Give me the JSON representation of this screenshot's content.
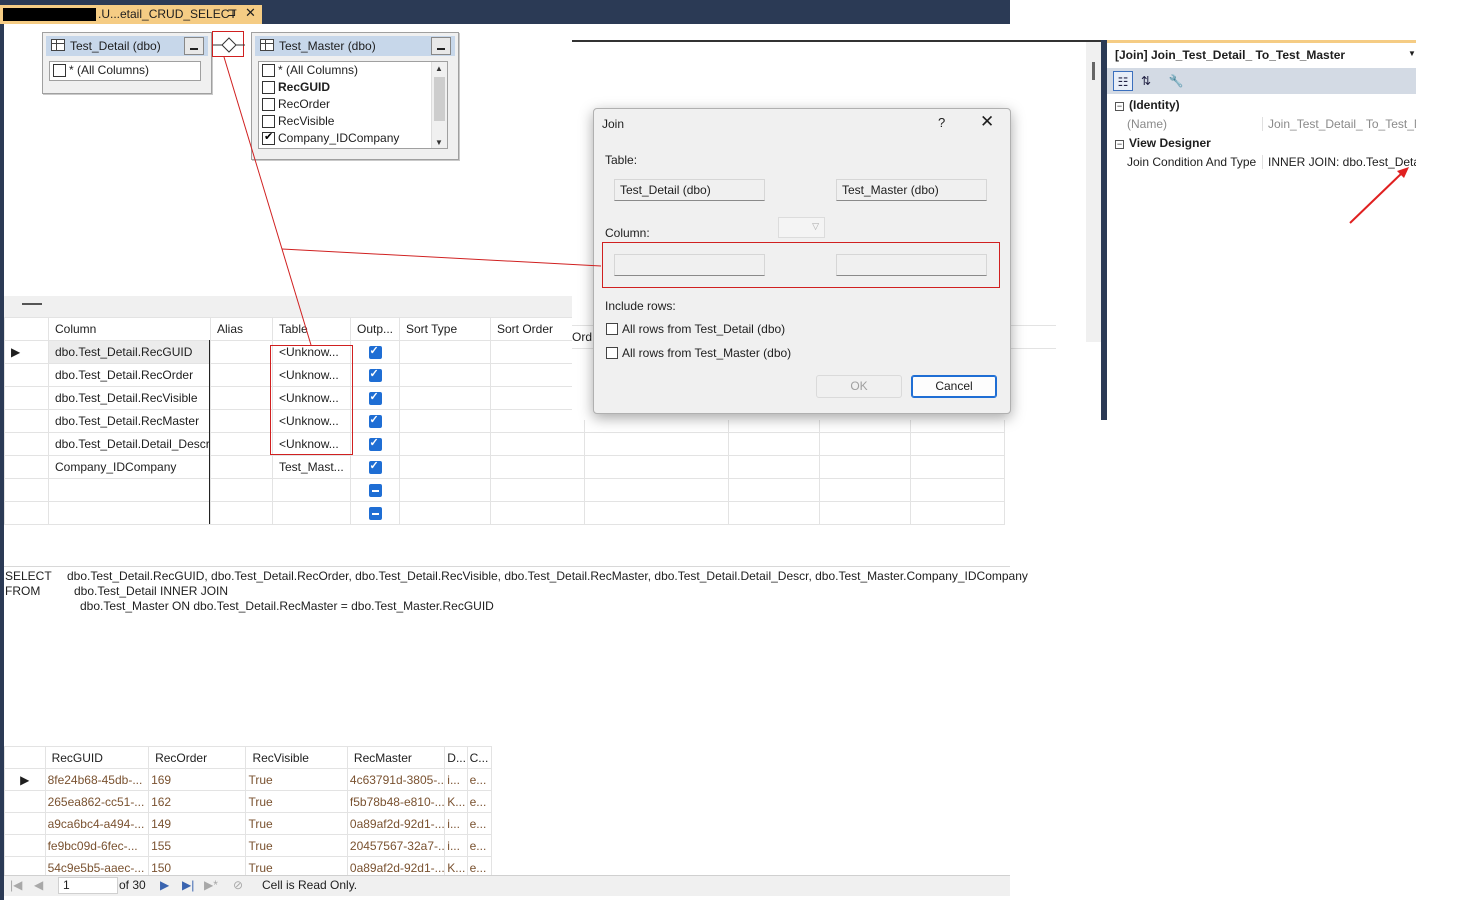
{
  "tab": {
    "title": ".U...etail_CRUD_SELECT",
    "pin": "⊐",
    "close": "✕"
  },
  "diagram": {
    "tables": [
      {
        "title": "Test_Detail (dbo)",
        "columns": [
          {
            "name": "* (All Columns)",
            "checked": false,
            "bold": false
          }
        ]
      },
      {
        "title": "Test_Master (dbo)",
        "columns": [
          {
            "name": "* (All Columns)",
            "checked": false,
            "bold": false
          },
          {
            "name": "RecGUID",
            "checked": false,
            "bold": true
          },
          {
            "name": "RecOrder",
            "checked": false,
            "bold": false
          },
          {
            "name": "RecVisible",
            "checked": false,
            "bold": false
          },
          {
            "name": "Company_IDCompany",
            "checked": true,
            "bold": false
          }
        ]
      }
    ]
  },
  "criteria": {
    "headers": [
      "Column",
      "Alias",
      "Table",
      "Outp...",
      "Sort Type",
      "Sort Order"
    ],
    "rows": [
      {
        "column": "dbo.Test_Detail.RecGUID",
        "alias": "",
        "table": "<Unknow...",
        "output": "checked",
        "current": true
      },
      {
        "column": "dbo.Test_Detail.RecOrder",
        "alias": "",
        "table": "<Unknow...",
        "output": "checked",
        "current": false
      },
      {
        "column": "dbo.Test_Detail.RecVisible",
        "alias": "",
        "table": "<Unknow...",
        "output": "checked",
        "current": false
      },
      {
        "column": "dbo.Test_Detail.RecMaster",
        "alias": "",
        "table": "<Unknow...",
        "output": "checked",
        "current": false
      },
      {
        "column": "dbo.Test_Detail.Detail_Descr",
        "alias": "",
        "table": "<Unknow...",
        "output": "checked",
        "current": false
      },
      {
        "column": "Company_IDCompany",
        "alias": "",
        "table": "Test_Mast...",
        "output": "checked",
        "current": false
      },
      {
        "column": "",
        "alias": "",
        "table": "",
        "output": "indeterminate",
        "current": false
      },
      {
        "column": "",
        "alias": "",
        "table": "",
        "output": "indeterminate",
        "current": false
      }
    ]
  },
  "sql": {
    "select_kw": "SELECT",
    "from_kw": "FROM",
    "select_list": "dbo.Test_Detail.RecGUID, dbo.Test_Detail.RecOrder, dbo.Test_Detail.RecVisible, dbo.Test_Detail.RecMaster, dbo.Test_Detail.Detail_Descr, dbo.Test_Master.Company_IDCompany",
    "from_line1": "dbo.Test_Detail INNER JOIN",
    "from_line2": "dbo.Test_Master ON dbo.Test_Detail.RecMaster = dbo.Test_Master.RecGUID"
  },
  "results": {
    "headers": [
      "RecGUID",
      "RecOrder",
      "RecVisible",
      "RecMaster",
      "D...",
      "C..."
    ],
    "rows": [
      [
        "8fe24b68-45db-...",
        "169",
        "True",
        "4c63791d-3805-...",
        "i...",
        "e..."
      ],
      [
        "265ea862-cc51-...",
        "162",
        "True",
        "f5b78b48-e810-...",
        "K...",
        "e..."
      ],
      [
        "a9ca6bc4-a494-...",
        "149",
        "True",
        "0a89af2d-92d1-...",
        "i...",
        "e..."
      ],
      [
        "fe9bc09d-6fec-...",
        "155",
        "True",
        "20457567-32a7-...",
        "i...",
        "e..."
      ],
      [
        "54c9e5b5-aaec-...",
        "150",
        "True",
        "0a89af2d-92d1-...",
        "K...",
        "e..."
      ]
    ],
    "nav": {
      "current_page": "1",
      "of_text": "of 30",
      "status": "Cell is Read Only."
    }
  },
  "back_window": {
    "partial_header": "Ord"
  },
  "join_dialog": {
    "title": "Join",
    "help": "?",
    "close": "✕",
    "table_label": "Table:",
    "left_table": "Test_Detail (dbo)",
    "right_table": "Test_Master (dbo)",
    "column_label": "Column:",
    "include_label": "Include rows:",
    "option_left": "All rows from Test_Detail (dbo)",
    "option_right": "All rows from Test_Master (dbo)",
    "option_left_checked": false,
    "option_right_checked": false,
    "ok_label": "OK",
    "cancel_label": "Cancel"
  },
  "properties": {
    "title": "[Join] Join_Test_Detail_ To_Test_Master",
    "categories": [
      {
        "name": "(Identity)",
        "rows": [
          {
            "name": "(Name)",
            "value": "Join_Test_Detail_ To_Test_Master",
            "dim": true
          }
        ]
      },
      {
        "name": "View Designer",
        "rows": [
          {
            "name": "Join Condition And Type",
            "value": "INNER JOIN: dbo.Test_Detail.RecMaster",
            "dim": false
          }
        ]
      }
    ]
  },
  "colors": {
    "accent": "#1f6ed4",
    "annotation_red": "#d02020",
    "tab_yellow": "#f5cc84",
    "frame_navy": "#2b3a55"
  }
}
